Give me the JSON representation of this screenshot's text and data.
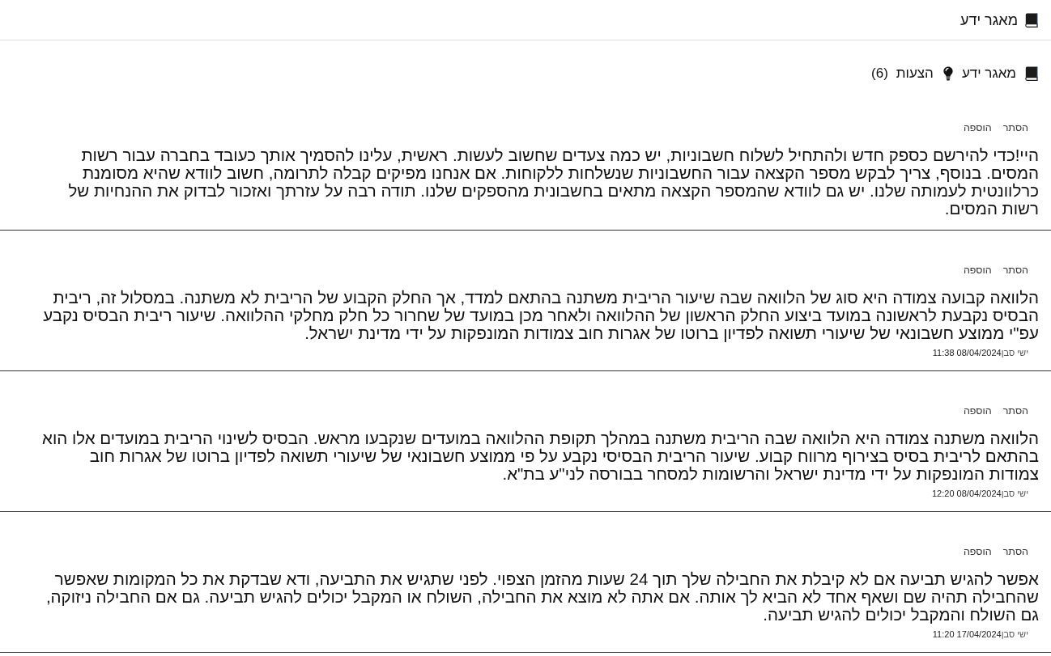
{
  "header": {
    "title": "מאגר ידע"
  },
  "breadcrumb": {
    "root": {
      "label": "מאגר ידע"
    },
    "current": {
      "label": "הצעות",
      "count": "(6)"
    }
  },
  "suggestions": [
    {
      "actions": [
        "הסתר",
        "הוספה"
      ],
      "text": "היי!כדי להירשם כספק חדש ולהתחיל לשלוח חשבוניות, יש כמה צעדים שחשוב לעשות. ראשית, עלינו להסמיך אותך כעובד בחברה עבור רשות המסים. בנוסף, צריך לבקש מספר הקצאה עבור החשבוניות שנשלחות ללקוחות. אם אנחנו מפיקים קבלה לתרומה, חשוב לוודא שהיא מסומנת כרלוונטית לעמותה שלנו. יש גם לוודא שהמספר הקצאה מתאים בחשבונית מהספקים שלנו. תודה רבה על עזרתך ואזכור לבדוק את ההנחיות של רשות המסים."
    },
    {
      "actions": [
        "הסתר",
        "הוספה"
      ],
      "text": "הלוואה קבועה צמודה היא סוג של הלוואה שבה שיעור הריבית משתנה בהתאם למדד, אך החלק הקבוע של הריבית לא משתנה. במסלול זה, ריבית הבסיס נקבעת לראשונה במועד ביצוע החלק הראשון של ההלוואה ולאחר מכן במועד של שחרור כל חלק מחלקי ההלוואה. שיעור ריבית הבסיס נקבע עפ\"י ממוצע חשבונאי של שיעורי תשואה לפדיון ברוטו של אגרות חוב צמודות המונפקות על ידי מדינת ישראל.",
      "author": "ישי סבן",
      "timestamp": "08/04/2024 11:38"
    },
    {
      "actions": [
        "הסתר",
        "הוספה"
      ],
      "text": "הלוואה משתנה צמודה היא הלוואה שבה הריבית משתנה במהלך תקופת ההלוואה במועדים שנקבעו מראש. הבסיס לשינוי הריבית במועדים אלו הוא בהתאם לריבית בסיס בצירוף מרווח קבוע. שיעור הריבית הבסיסי נקבע על פי ממוצע חשבונאי של שיעורי תשואה לפדיון ברוטו של אגרות חוב צמודות המונפקות על ידי מדינת ישראל והרשומות למסחר בבורסה לני\"ע בת\"א.",
      "author": "ישי סבן",
      "timestamp": "08/04/2024 12:20"
    },
    {
      "actions": [
        "הסתר",
        "הוספה"
      ],
      "text": "אפשר להגיש תביעה אם לא קיבלת את החבילה שלך תוך 24 שעות מהזמן הצפוי. לפני שתגיש את התביעה, ודא שבדקת את כל המקומות שאפשר שהחבילה תהיה שם ושאף אחד לא הביא לך אותה. אם אתה לא מוצא את החבילה, השולח או המקבל יכולים להגיש תביעה. גם אם החבילה ניזוקה, גם השולח והמקבל יכולים להגיש תביעה.",
      "author": "ישי סבן",
      "timestamp": "17/04/2024 11:20"
    }
  ]
}
